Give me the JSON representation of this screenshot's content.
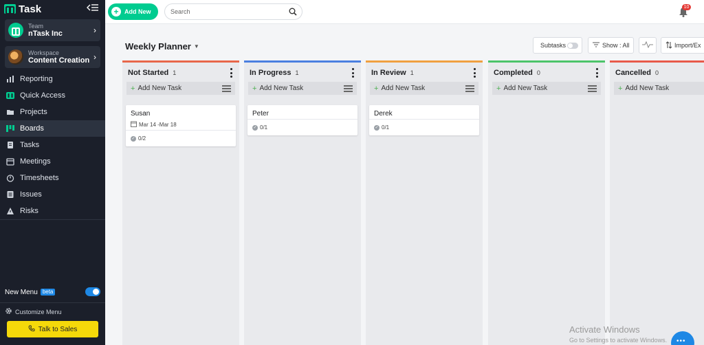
{
  "app": {
    "logo_text": "Task"
  },
  "sidebar": {
    "team": {
      "label": "Team",
      "name": "nTask Inc"
    },
    "workspace": {
      "label": "Workspace",
      "name": "Content Creation"
    },
    "items": [
      {
        "label": "Reporting",
        "icon": "reporting-icon"
      },
      {
        "label": "Quick Access",
        "icon": "quick-access-icon"
      },
      {
        "label": "Projects",
        "icon": "folder-icon"
      },
      {
        "label": "Boards",
        "icon": "boards-icon",
        "active": true
      },
      {
        "label": "Tasks",
        "icon": "tasks-icon"
      },
      {
        "label": "Meetings",
        "icon": "calendar-icon"
      },
      {
        "label": "Timesheets",
        "icon": "timer-icon"
      },
      {
        "label": "Issues",
        "icon": "issues-icon"
      },
      {
        "label": "Risks",
        "icon": "warning-icon"
      }
    ],
    "new_menu_label": "New Menu",
    "beta_label": "beta",
    "customize_label": "Customize Menu",
    "talk_label": "Talk to Sales"
  },
  "topbar": {
    "add_new_label": "Add New",
    "search_placeholder": "Search",
    "notification_count": "10"
  },
  "header": {
    "title": "Weekly Planner",
    "subtasks_label": "Subtasks",
    "show_label": "Show : All",
    "import_label": "Import/Ex"
  },
  "board": {
    "add_task_label": "Add New Task",
    "columns": [
      {
        "name": "Not Started",
        "count": "1",
        "color": "#e8674a",
        "cards": [
          {
            "title": "Susan",
            "dates": "Mar 14 -Mar 18",
            "progress": "0/2"
          }
        ]
      },
      {
        "name": "In Progress",
        "count": "1",
        "color": "#4a7fe0",
        "cards": [
          {
            "title": "Peter",
            "progress": "0/1"
          }
        ]
      },
      {
        "name": "In Review",
        "count": "1",
        "color": "#f0a040",
        "cards": [
          {
            "title": "Derek",
            "progress": "0/1"
          }
        ]
      },
      {
        "name": "Completed",
        "count": "0",
        "color": "#4cc46a",
        "cards": []
      },
      {
        "name": "Cancelled",
        "count": "0",
        "color": "#e85a4a",
        "cards": []
      }
    ]
  },
  "watermark": {
    "line1": "Activate Windows",
    "line2": "Go to Settings to activate Windows."
  }
}
